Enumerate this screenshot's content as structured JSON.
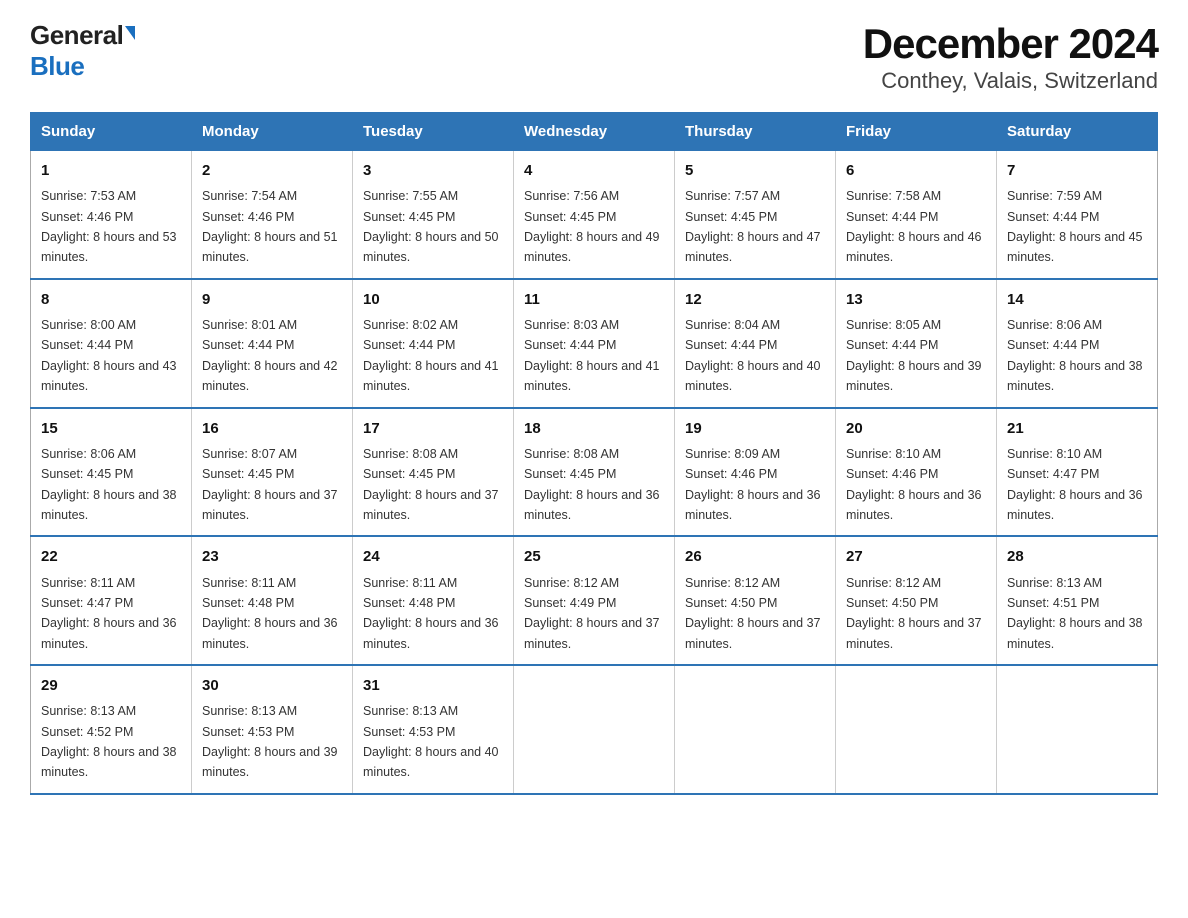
{
  "header": {
    "logo_general": "General",
    "logo_blue": "Blue",
    "title": "December 2024",
    "subtitle": "Conthey, Valais, Switzerland"
  },
  "days_of_week": [
    "Sunday",
    "Monday",
    "Tuesday",
    "Wednesday",
    "Thursday",
    "Friday",
    "Saturday"
  ],
  "weeks": [
    [
      {
        "day": "1",
        "sunrise": "7:53 AM",
        "sunset": "4:46 PM",
        "daylight": "8 hours and 53 minutes."
      },
      {
        "day": "2",
        "sunrise": "7:54 AM",
        "sunset": "4:46 PM",
        "daylight": "8 hours and 51 minutes."
      },
      {
        "day": "3",
        "sunrise": "7:55 AM",
        "sunset": "4:45 PM",
        "daylight": "8 hours and 50 minutes."
      },
      {
        "day": "4",
        "sunrise": "7:56 AM",
        "sunset": "4:45 PM",
        "daylight": "8 hours and 49 minutes."
      },
      {
        "day": "5",
        "sunrise": "7:57 AM",
        "sunset": "4:45 PM",
        "daylight": "8 hours and 47 minutes."
      },
      {
        "day": "6",
        "sunrise": "7:58 AM",
        "sunset": "4:44 PM",
        "daylight": "8 hours and 46 minutes."
      },
      {
        "day": "7",
        "sunrise": "7:59 AM",
        "sunset": "4:44 PM",
        "daylight": "8 hours and 45 minutes."
      }
    ],
    [
      {
        "day": "8",
        "sunrise": "8:00 AM",
        "sunset": "4:44 PM",
        "daylight": "8 hours and 43 minutes."
      },
      {
        "day": "9",
        "sunrise": "8:01 AM",
        "sunset": "4:44 PM",
        "daylight": "8 hours and 42 minutes."
      },
      {
        "day": "10",
        "sunrise": "8:02 AM",
        "sunset": "4:44 PM",
        "daylight": "8 hours and 41 minutes."
      },
      {
        "day": "11",
        "sunrise": "8:03 AM",
        "sunset": "4:44 PM",
        "daylight": "8 hours and 41 minutes."
      },
      {
        "day": "12",
        "sunrise": "8:04 AM",
        "sunset": "4:44 PM",
        "daylight": "8 hours and 40 minutes."
      },
      {
        "day": "13",
        "sunrise": "8:05 AM",
        "sunset": "4:44 PM",
        "daylight": "8 hours and 39 minutes."
      },
      {
        "day": "14",
        "sunrise": "8:06 AM",
        "sunset": "4:44 PM",
        "daylight": "8 hours and 38 minutes."
      }
    ],
    [
      {
        "day": "15",
        "sunrise": "8:06 AM",
        "sunset": "4:45 PM",
        "daylight": "8 hours and 38 minutes."
      },
      {
        "day": "16",
        "sunrise": "8:07 AM",
        "sunset": "4:45 PM",
        "daylight": "8 hours and 37 minutes."
      },
      {
        "day": "17",
        "sunrise": "8:08 AM",
        "sunset": "4:45 PM",
        "daylight": "8 hours and 37 minutes."
      },
      {
        "day": "18",
        "sunrise": "8:08 AM",
        "sunset": "4:45 PM",
        "daylight": "8 hours and 36 minutes."
      },
      {
        "day": "19",
        "sunrise": "8:09 AM",
        "sunset": "4:46 PM",
        "daylight": "8 hours and 36 minutes."
      },
      {
        "day": "20",
        "sunrise": "8:10 AM",
        "sunset": "4:46 PM",
        "daylight": "8 hours and 36 minutes."
      },
      {
        "day": "21",
        "sunrise": "8:10 AM",
        "sunset": "4:47 PM",
        "daylight": "8 hours and 36 minutes."
      }
    ],
    [
      {
        "day": "22",
        "sunrise": "8:11 AM",
        "sunset": "4:47 PM",
        "daylight": "8 hours and 36 minutes."
      },
      {
        "day": "23",
        "sunrise": "8:11 AM",
        "sunset": "4:48 PM",
        "daylight": "8 hours and 36 minutes."
      },
      {
        "day": "24",
        "sunrise": "8:11 AM",
        "sunset": "4:48 PM",
        "daylight": "8 hours and 36 minutes."
      },
      {
        "day": "25",
        "sunrise": "8:12 AM",
        "sunset": "4:49 PM",
        "daylight": "8 hours and 37 minutes."
      },
      {
        "day": "26",
        "sunrise": "8:12 AM",
        "sunset": "4:50 PM",
        "daylight": "8 hours and 37 minutes."
      },
      {
        "day": "27",
        "sunrise": "8:12 AM",
        "sunset": "4:50 PM",
        "daylight": "8 hours and 37 minutes."
      },
      {
        "day": "28",
        "sunrise": "8:13 AM",
        "sunset": "4:51 PM",
        "daylight": "8 hours and 38 minutes."
      }
    ],
    [
      {
        "day": "29",
        "sunrise": "8:13 AM",
        "sunset": "4:52 PM",
        "daylight": "8 hours and 38 minutes."
      },
      {
        "day": "30",
        "sunrise": "8:13 AM",
        "sunset": "4:53 PM",
        "daylight": "8 hours and 39 minutes."
      },
      {
        "day": "31",
        "sunrise": "8:13 AM",
        "sunset": "4:53 PM",
        "daylight": "8 hours and 40 minutes."
      },
      null,
      null,
      null,
      null
    ]
  ],
  "labels": {
    "sunrise_prefix": "Sunrise: ",
    "sunset_prefix": "Sunset: ",
    "daylight_prefix": "Daylight: "
  }
}
